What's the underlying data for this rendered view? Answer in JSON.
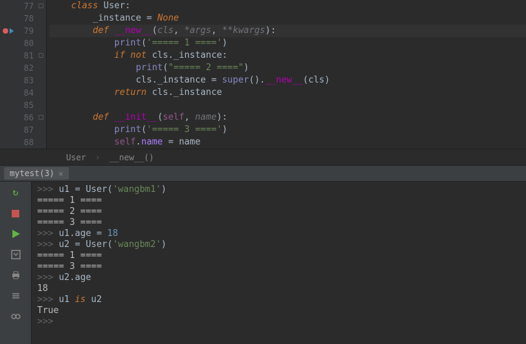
{
  "editor": {
    "lines": {
      "77": {
        "ln": "77",
        "class_kw": "class",
        "class_name": "User",
        "colon": ":"
      },
      "78": {
        "ln": "78",
        "attr": "_instance",
        "eq": " = ",
        "none": "None"
      },
      "79": {
        "ln": "79",
        "def": "def",
        "name": "__new__",
        "lp": "(",
        "p1": "cls",
        "c1": ", ",
        "p2": "*args",
        "c2": ", ",
        "p3": "**kwargs",
        "rp": ")",
        "colon": ":"
      },
      "80": {
        "ln": "80",
        "call": "print",
        "lp": "(",
        "s": "'===== 1 ===='",
        "rp": ")"
      },
      "81": {
        "ln": "81",
        "kw1": "if not ",
        "id": "cls",
        "dot": ".",
        "attr": "_instance",
        "colon": ":"
      },
      "82": {
        "ln": "82",
        "call": "print",
        "lp": "(",
        "s": "\"===== 2 ====\"",
        "rp": ")"
      },
      "83": {
        "ln": "83",
        "id": "cls",
        "dot": ".",
        "attr": "_instance",
        "eq": " = ",
        "sup": "super",
        "p": "()",
        "dot2": ".",
        "dnew": "__new__",
        "lp": "(",
        "arg": "cls",
        "rp": ")"
      },
      "84": {
        "ln": "84",
        "ret": "return ",
        "id": "cls",
        "dot": ".",
        "attr": "_instance"
      },
      "85": {
        "ln": "85"
      },
      "86": {
        "ln": "86",
        "def": "def",
        "name": "__init__",
        "lp": "(",
        "self": "self",
        "c": ", ",
        "p": "name",
        "rp": ")",
        "colon": ":"
      },
      "87": {
        "ln": "87",
        "call": "print",
        "lp": "(",
        "s": "'===== 3 ===='",
        "rp": ")"
      },
      "88": {
        "ln": "88",
        "self": "self",
        "dot": ".",
        "attr": "name",
        "eq": " = ",
        "id": "name"
      }
    }
  },
  "breadcrumb": {
    "a": "User",
    "b": "__new__()"
  },
  "tab": {
    "label": "mytest(3)"
  },
  "toolbar_icons": {
    "rerun": "rerun-icon",
    "stop": "stop-icon",
    "run": "run-icon",
    "scroll": "scroll-to-end-icon",
    "print": "print-icon",
    "history": "history-icon",
    "link": "soft-wrap-icon"
  },
  "console": {
    "lines": [
      {
        "prompt": ">>> ",
        "tokens": [
          [
            "cid",
            "u1 "
          ],
          [
            "op",
            "= "
          ],
          [
            "ccls",
            "User"
          ],
          [
            "op",
            "("
          ],
          [
            "cstr",
            "'wangbm1'"
          ],
          [
            "op",
            ")"
          ]
        ]
      },
      {
        "tokens": [
          [
            "cout",
            "===== 1 ===="
          ]
        ]
      },
      {
        "tokens": [
          [
            "cout",
            "===== 2 ===="
          ]
        ]
      },
      {
        "tokens": [
          [
            "cout",
            "===== 3 ===="
          ]
        ]
      },
      {
        "prompt": ">>> ",
        "tokens": [
          [
            "cid",
            "u1"
          ],
          [
            "op",
            "."
          ],
          [
            "cid",
            "age "
          ],
          [
            "op",
            "= "
          ],
          [
            "cnum",
            "18"
          ]
        ]
      },
      {
        "prompt": ">>> ",
        "tokens": [
          [
            "cid",
            "u2 "
          ],
          [
            "op",
            "= "
          ],
          [
            "ccls",
            "User"
          ],
          [
            "op",
            "("
          ],
          [
            "cstr",
            "'wangbm2'"
          ],
          [
            "op",
            ")"
          ]
        ]
      },
      {
        "tokens": [
          [
            "cout",
            "===== 1 ===="
          ]
        ]
      },
      {
        "tokens": [
          [
            "cout",
            "===== 3 ===="
          ]
        ]
      },
      {
        "prompt": ">>> ",
        "tokens": [
          [
            "cid",
            "u2"
          ],
          [
            "op",
            "."
          ],
          [
            "cid",
            "age"
          ]
        ]
      },
      {
        "tokens": [
          [
            "cout",
            "18"
          ]
        ]
      },
      {
        "prompt": ">>> ",
        "tokens": [
          [
            "cid",
            "u1 "
          ],
          [
            "ckw",
            "is"
          ],
          [
            "cid",
            " u2"
          ]
        ]
      },
      {
        "tokens": [
          [
            "cout",
            "True"
          ]
        ]
      },
      {
        "prompt": ">>> ",
        "tokens": []
      }
    ]
  }
}
